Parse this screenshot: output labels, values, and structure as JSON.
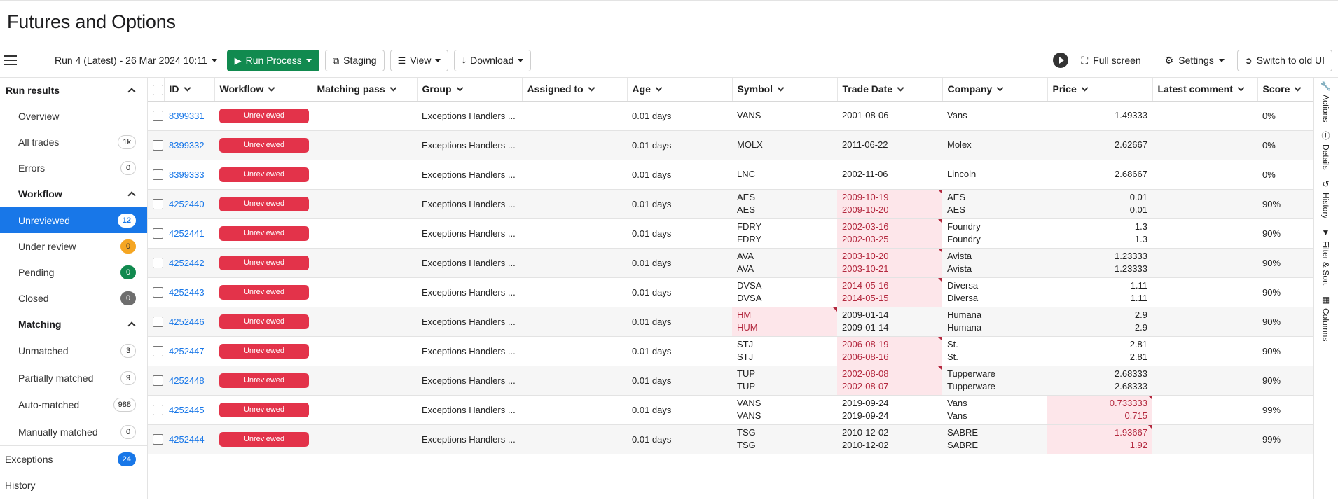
{
  "page": {
    "title": "Futures and Options"
  },
  "toolbar": {
    "run_label": "Run 4 (Latest) - 26 Mar 2024 10:11",
    "run_process": "Run Process",
    "staging": "Staging",
    "view": "View",
    "download": "Download",
    "full_screen": "Full screen",
    "settings": "Settings",
    "switch_ui": "Switch to old UI"
  },
  "sidebar": {
    "run_results": "Run results",
    "overview": "Overview",
    "all_trades": {
      "label": "All trades",
      "count": "1k"
    },
    "errors": {
      "label": "Errors",
      "count": "0"
    },
    "workflow": "Workflow",
    "workflow_items": [
      {
        "label": "Unreviewed",
        "count": "12"
      },
      {
        "label": "Under review",
        "count": "0"
      },
      {
        "label": "Pending",
        "count": "0"
      },
      {
        "label": "Closed",
        "count": "0"
      }
    ],
    "matching": "Matching",
    "matching_items": [
      {
        "label": "Unmatched",
        "count": "3"
      },
      {
        "label": "Partially matched",
        "count": "9"
      },
      {
        "label": "Auto-matched",
        "count": "988"
      },
      {
        "label": "Manually matched",
        "count": "0"
      }
    ],
    "exceptions": {
      "label": "Exceptions",
      "count": "24"
    },
    "history": "History"
  },
  "table": {
    "columns": [
      "ID",
      "Workflow",
      "Matching pass",
      "Group",
      "Assigned to",
      "Age",
      "Symbol",
      "Trade Date",
      "Company",
      "Price",
      "Latest comment",
      "Score"
    ],
    "rows": [
      {
        "id": "8399331",
        "status": "Unreviewed",
        "group": "Exceptions Handlers ...",
        "age": "0.01 days",
        "symbol": [
          "VANS"
        ],
        "trade_date": [
          "2001-08-06"
        ],
        "company": [
          "Vans"
        ],
        "price": [
          "1.49333"
        ],
        "score": "0%",
        "diff": []
      },
      {
        "id": "8399332",
        "status": "Unreviewed",
        "group": "Exceptions Handlers ...",
        "age": "0.01 days",
        "symbol": [
          "MOLX"
        ],
        "trade_date": [
          "2011-06-22"
        ],
        "company": [
          "Molex"
        ],
        "price": [
          "2.62667"
        ],
        "score": "0%",
        "diff": []
      },
      {
        "id": "8399333",
        "status": "Unreviewed",
        "group": "Exceptions Handlers ...",
        "age": "0.01 days",
        "symbol": [
          "LNC"
        ],
        "trade_date": [
          "2002-11-06"
        ],
        "company": [
          "Lincoln"
        ],
        "price": [
          "2.68667"
        ],
        "score": "0%",
        "diff": []
      },
      {
        "id": "4252440",
        "status": "Unreviewed",
        "group": "Exceptions Handlers ...",
        "age": "0.01 days",
        "symbol": [
          "AES",
          "AES"
        ],
        "trade_date": [
          "2009-10-19",
          "2009-10-20"
        ],
        "company": [
          "AES",
          "AES"
        ],
        "price": [
          "0.01",
          "0.01"
        ],
        "score": "90%",
        "diff": [
          "trade_date"
        ]
      },
      {
        "id": "4252441",
        "status": "Unreviewed",
        "group": "Exceptions Handlers ...",
        "age": "0.01 days",
        "symbol": [
          "FDRY",
          "FDRY"
        ],
        "trade_date": [
          "2002-03-16",
          "2002-03-25"
        ],
        "company": [
          "Foundry",
          "Foundry"
        ],
        "price": [
          "1.3",
          "1.3"
        ],
        "score": "90%",
        "diff": [
          "trade_date"
        ]
      },
      {
        "id": "4252442",
        "status": "Unreviewed",
        "group": "Exceptions Handlers ...",
        "age": "0.01 days",
        "symbol": [
          "AVA",
          "AVA"
        ],
        "trade_date": [
          "2003-10-20",
          "2003-10-21"
        ],
        "company": [
          "Avista",
          "Avista"
        ],
        "price": [
          "1.23333",
          "1.23333"
        ],
        "score": "90%",
        "diff": [
          "trade_date"
        ]
      },
      {
        "id": "4252443",
        "status": "Unreviewed",
        "group": "Exceptions Handlers ...",
        "age": "0.01 days",
        "symbol": [
          "DVSA",
          "DVSA"
        ],
        "trade_date": [
          "2014-05-16",
          "2014-05-15"
        ],
        "company": [
          "Diversa",
          "Diversa"
        ],
        "price": [
          "1.11",
          "1.11"
        ],
        "score": "90%",
        "diff": [
          "trade_date"
        ]
      },
      {
        "id": "4252446",
        "status": "Unreviewed",
        "group": "Exceptions Handlers ...",
        "age": "0.01 days",
        "symbol": [
          "HM",
          "HUM"
        ],
        "trade_date": [
          "2009-01-14",
          "2009-01-14"
        ],
        "company": [
          "Humana",
          "Humana"
        ],
        "price": [
          "2.9",
          "2.9"
        ],
        "score": "90%",
        "diff": [
          "symbol"
        ]
      },
      {
        "id": "4252447",
        "status": "Unreviewed",
        "group": "Exceptions Handlers ...",
        "age": "0.01 days",
        "symbol": [
          "STJ",
          "STJ"
        ],
        "trade_date": [
          "2006-08-19",
          "2006-08-16"
        ],
        "company": [
          "St.",
          "St."
        ],
        "price": [
          "2.81",
          "2.81"
        ],
        "score": "90%",
        "diff": [
          "trade_date"
        ]
      },
      {
        "id": "4252448",
        "status": "Unreviewed",
        "group": "Exceptions Handlers ...",
        "age": "0.01 days",
        "symbol": [
          "TUP",
          "TUP"
        ],
        "trade_date": [
          "2002-08-08",
          "2002-08-07"
        ],
        "company": [
          "Tupperware",
          "Tupperware"
        ],
        "price": [
          "2.68333",
          "2.68333"
        ],
        "score": "90%",
        "diff": [
          "trade_date"
        ]
      },
      {
        "id": "4252445",
        "status": "Unreviewed",
        "group": "Exceptions Handlers ...",
        "age": "0.01 days",
        "symbol": [
          "VANS",
          "VANS"
        ],
        "trade_date": [
          "2019-09-24",
          "2019-09-24"
        ],
        "company": [
          "Vans",
          "Vans"
        ],
        "price": [
          "0.733333",
          "0.715"
        ],
        "score": "99%",
        "diff": [
          "price"
        ]
      },
      {
        "id": "4252444",
        "status": "Unreviewed",
        "group": "Exceptions Handlers ...",
        "age": "0.01 days",
        "symbol": [
          "TSG",
          "TSG"
        ],
        "trade_date": [
          "2010-12-02",
          "2010-12-02"
        ],
        "company": [
          "SABRE",
          "SABRE"
        ],
        "price": [
          "1.93667",
          "1.92"
        ],
        "score": "99%",
        "diff": [
          "price"
        ]
      }
    ]
  },
  "rail": [
    "Actions",
    "Details",
    "History",
    "Filter & Sort",
    "Columns"
  ],
  "icons": {
    "actions": "wrench-icon",
    "details": "info-icon",
    "history": "history-icon",
    "filter": "filter-icon",
    "columns": "columns-icon"
  },
  "colors": {
    "primary": "#118a4f",
    "accent": "#1877e8",
    "status": "#e3334a",
    "diff_bg": "#fde6ea",
    "diff_text": "#b3283e"
  }
}
